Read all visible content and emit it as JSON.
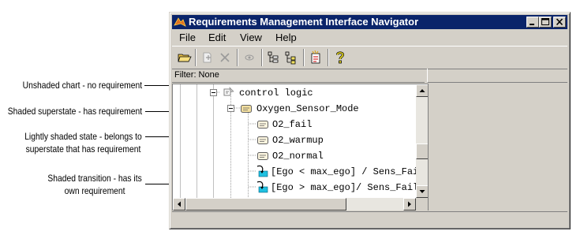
{
  "window": {
    "title": "Requirements Management Interface Navigator"
  },
  "menu": {
    "items": [
      "File",
      "Edit",
      "View",
      "Help"
    ]
  },
  "toolbar": {
    "buttons": [
      "open-icon",
      "add-link-icon",
      "delete-icon",
      "view-icon",
      "expand-tree-icon",
      "collapse-tree-icon",
      "new-icon",
      "help-icon"
    ]
  },
  "filter": {
    "label": "Filter: None"
  },
  "tree": {
    "items": [
      {
        "label": "control logic",
        "icon": "chart-icon"
      },
      {
        "label": "Oxygen_Sensor_Mode",
        "icon": "superstate-icon"
      },
      {
        "label": "O2_fail",
        "icon": "state-icon"
      },
      {
        "label": "O2_warmup",
        "icon": "state-icon"
      },
      {
        "label": "O2_normal",
        "icon": "state-icon"
      },
      {
        "label": "[Ego < max_ego] / Sens_Fail",
        "icon": "transition-icon"
      },
      {
        "label": "[Ego > max_ego]/ Sens_Fail",
        "icon": "transition-icon"
      }
    ]
  },
  "callouts": [
    {
      "lines": [
        "Unshaded chart - no requirement"
      ]
    },
    {
      "lines": [
        "Shaded superstate - has requirement"
      ]
    },
    {
      "lines": [
        "Lightly shaded state - belongs to",
        "superstate that has requirement"
      ]
    },
    {
      "lines": [
        "Shaded transition - has its",
        "own requirement"
      ]
    }
  ],
  "colors": {
    "titlebar": "#0a246a",
    "face": "#d4d0c8",
    "superstate_fill": "#f4e0a0",
    "transition_fill": "#20c0e0"
  }
}
